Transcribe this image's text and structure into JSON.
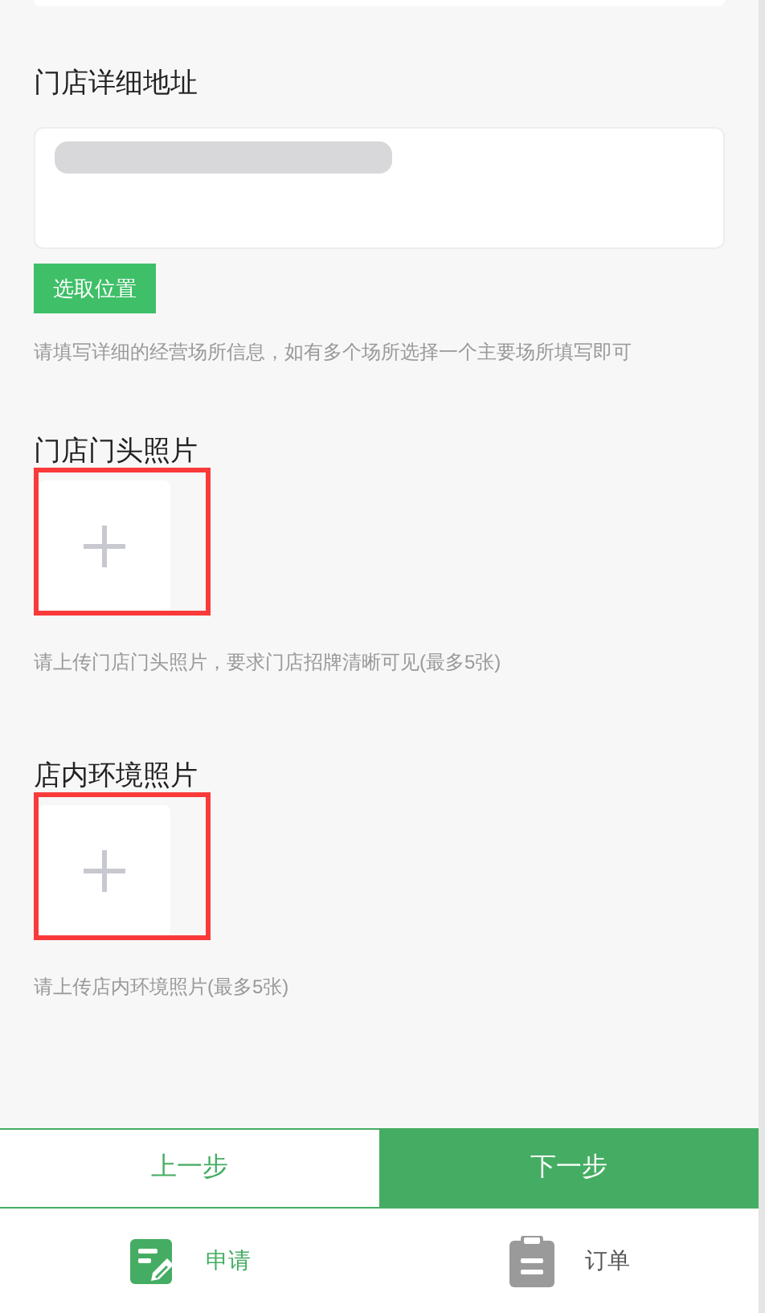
{
  "address": {
    "title": "门店详细地址",
    "locate_button": "选取位置",
    "hint": "请填写详细的经营场所信息，如有多个场所选择一个主要场所填写即可"
  },
  "photo_sections": [
    {
      "title": "门店门头照片",
      "hint": "请上传门店门头照片，要求门店招牌清晰可见(最多5张)",
      "highlighted": true
    },
    {
      "title": "店内环境照片",
      "hint": "请上传店内环境照片(最多5张)",
      "highlighted": true
    }
  ],
  "steps": [
    {
      "label": "上一步",
      "kind": "prev"
    },
    {
      "label": "下一步",
      "kind": "next"
    }
  ],
  "tabs": [
    {
      "label": "申请",
      "selected": true,
      "kind": "apply"
    },
    {
      "label": "订单",
      "selected": false,
      "kind": "orders"
    }
  ]
}
